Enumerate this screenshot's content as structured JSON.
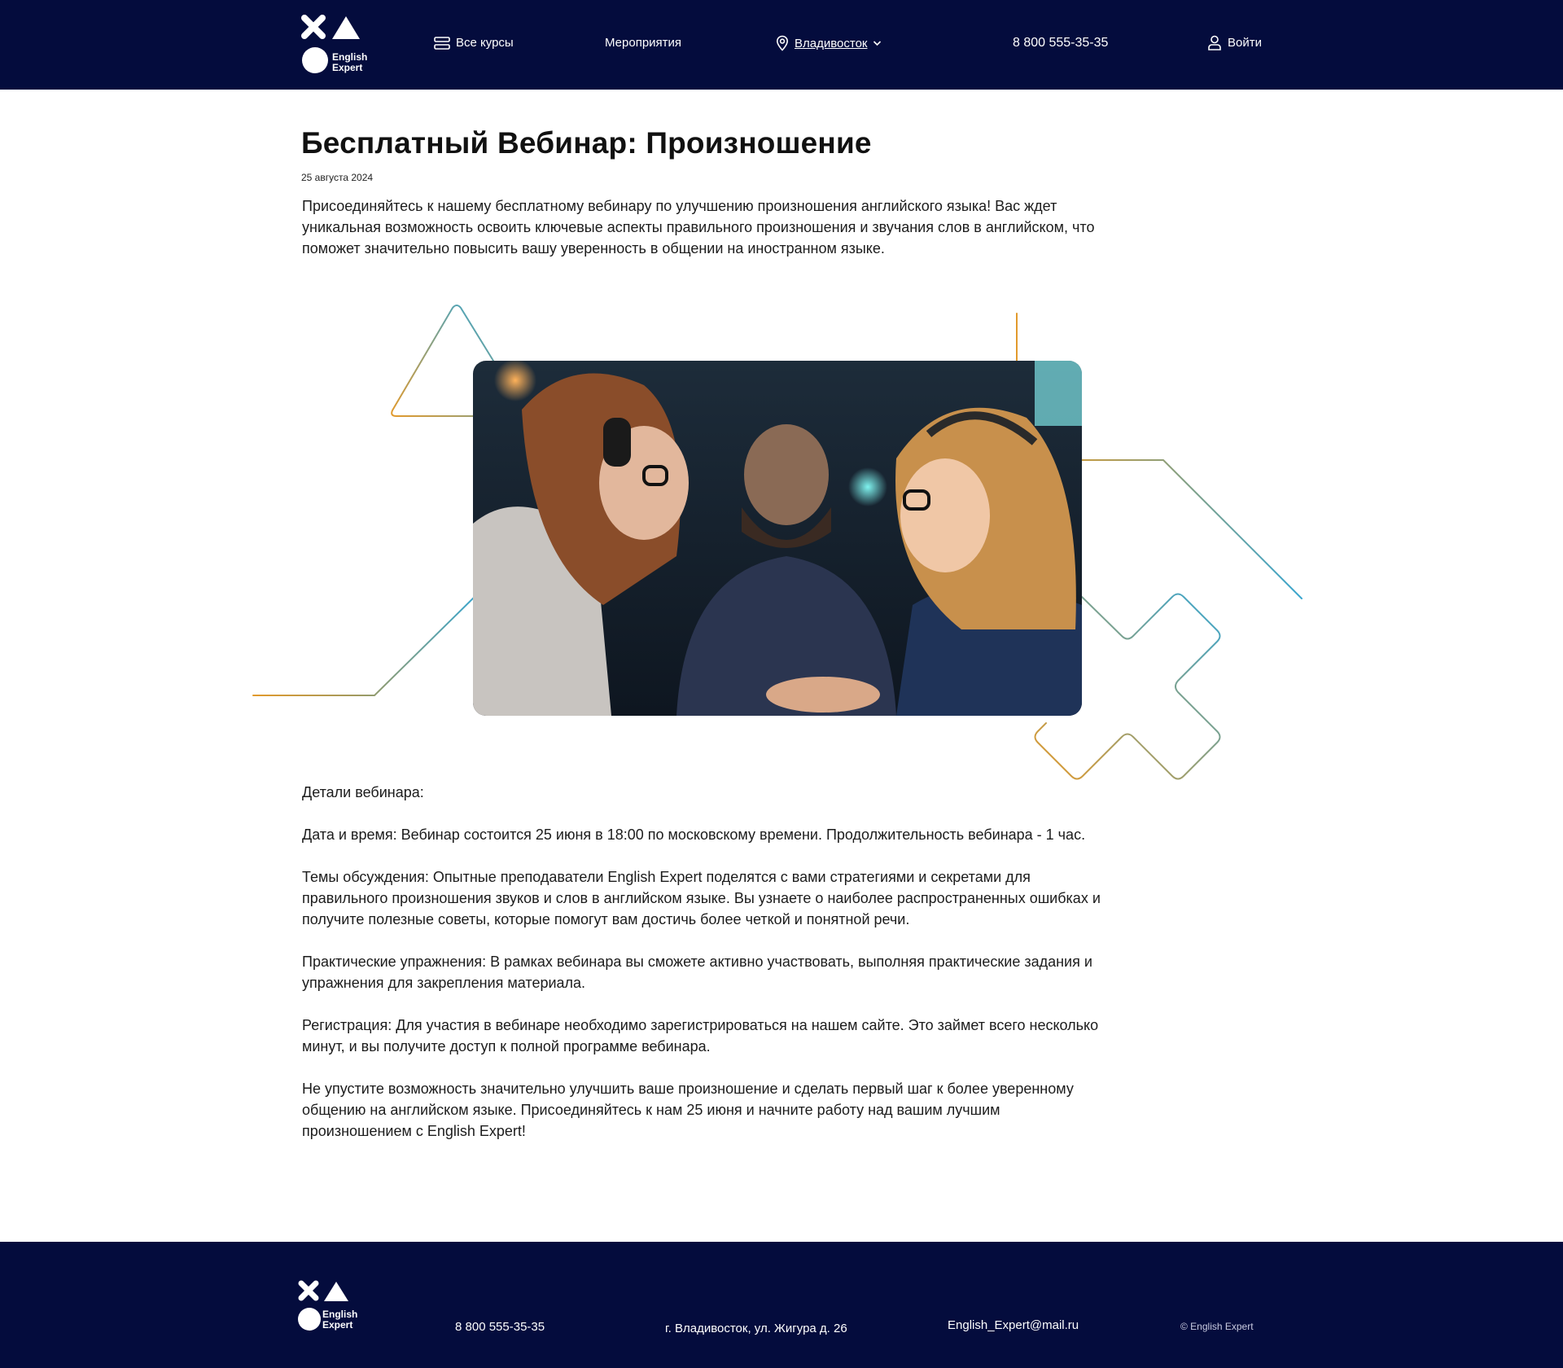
{
  "brand": {
    "name_line1": "English",
    "name_line2": "Expert"
  },
  "header": {
    "nav": {
      "courses_label": "Все курсы",
      "events_label": "Мероприятия",
      "city_label": "Владивосток",
      "phone": "8 800 555-35-35",
      "login_label": "Войти"
    },
    "icons": [
      "courses-menu-icon",
      "location-pin-icon",
      "chevron-down-icon",
      "user-icon"
    ]
  },
  "article": {
    "title": "Бесплатный Вебинар: Произношение",
    "date": "25 августа 2024",
    "intro": "Присоединяйтесь к нашему бесплатному вебинару по улучшению произношения английского языка! Вас ждет уникальная возможность освоить ключевые аспекты правильного произношения и звучания слов в английском, что поможет значительно повысить вашу уверенность в общении на иностранном языке.",
    "paragraphs": [
      "Детали вебинара:",
      "Дата и время: Вебинар состоится 25 июня в 18:00 по московскому времени. Продолжительность вебинара - 1 час.",
      "Темы обсуждения: Опытные преподаватели English Expert поделятся с вами стратегиями и секретами для правильного произношения звуков и слов в английском языке. Вы узнаете о наиболее распространенных ошибках и получите полезные советы, которые помогут вам достичь более четкой и понятной речи.",
      "Практические упражнения: В рамках вебинара вы сможете активно участвовать, выполняя практические задания и упражнения для закрепления материала.",
      "Регистрация: Для участия в вебинаре необходимо зарегистрироваться на нашем сайте. Это займет всего несколько минут, и вы получите доступ к полной программе вебинара.",
      "Не упустите возможность значительно улучшить ваше произношение и сделать первый шаг к более уверенному общению на английском языке. Присоединяйтесь к нам 25 июня и начните работу над вашим лучшим произношением с English Expert!"
    ]
  },
  "footer": {
    "phone": "8 800 555-35-35",
    "address": "г. Владивосток, ул. Жигура д. 26",
    "email": "English_Expert@mail.ru",
    "copyright": "© English Expert"
  },
  "colors": {
    "header_bg": "#040c3d",
    "footer_bg": "#040c3d",
    "deco_orange": "#e29a2c",
    "deco_blue": "#3aa6cf"
  }
}
